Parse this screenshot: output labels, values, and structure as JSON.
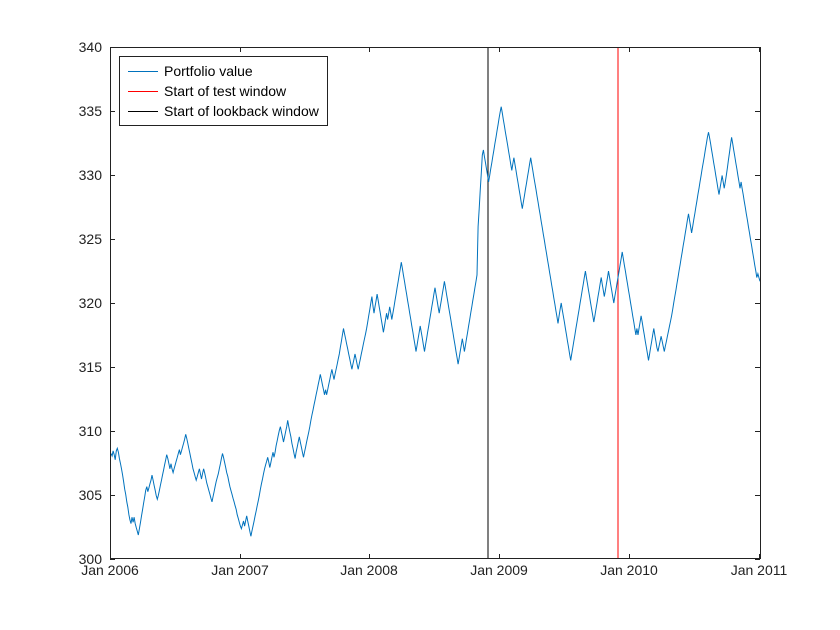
{
  "chart_data": {
    "type": "line",
    "xlabel": "",
    "ylabel": "",
    "title": "",
    "x_ticks": [
      "Jan 2006",
      "Jan 2007",
      "Jan 2008",
      "Jan 2009",
      "Jan 2010",
      "Jan 2011"
    ],
    "y_ticks": [
      300,
      305,
      310,
      315,
      320,
      325,
      330,
      335,
      340
    ],
    "xlim": [
      "2006-01-01",
      "2011-01-10"
    ],
    "ylim": [
      300,
      340
    ],
    "legend": {
      "position": "upper-left",
      "entries": [
        "Portfolio value",
        "Start of test window",
        "Start of lookback window"
      ]
    },
    "annotations": [
      {
        "type": "vline",
        "x": "2008-12-01",
        "color": "#000",
        "label": "Start of lookback window"
      },
      {
        "type": "vline",
        "x": "2009-12-01",
        "color": "#f00",
        "label": "Start of test window"
      }
    ],
    "series": [
      {
        "name": "Portfolio value",
        "color": "#0072BD",
        "x_start": "2006-01-01",
        "x_end": "2011-01-10",
        "values": [
          308.2,
          308.0,
          308.4,
          308.1,
          307.7,
          308.4,
          308.6,
          308.3,
          307.8,
          307.4,
          307.0,
          306.5,
          306.0,
          305.4,
          305.0,
          304.4,
          304.0,
          303.4,
          303.0,
          302.7,
          303.2,
          302.8,
          303.2,
          302.7,
          302.4,
          302.1,
          301.8,
          302.3,
          302.8,
          303.3,
          303.8,
          304.3,
          304.8,
          305.3,
          305.6,
          305.2,
          305.5,
          305.8,
          306.1,
          306.5,
          306.1,
          305.7,
          305.3,
          304.9,
          304.6,
          304.9,
          305.3,
          305.7,
          306.1,
          306.5,
          306.9,
          307.3,
          307.7,
          308.1,
          307.8,
          307.4,
          307.0,
          307.4,
          307.0,
          306.7,
          307.0,
          307.3,
          307.6,
          307.9,
          308.2,
          308.5,
          308.1,
          308.4,
          308.7,
          309.0,
          309.3,
          309.7,
          309.4,
          309.0,
          308.6,
          308.2,
          307.8,
          307.4,
          307.0,
          306.7,
          306.4,
          306.1,
          306.4,
          306.7,
          307.0,
          306.6,
          306.2,
          306.6,
          307.0,
          306.7,
          306.3,
          305.9,
          305.6,
          305.3,
          305.0,
          304.7,
          304.4,
          304.8,
          305.2,
          305.6,
          306.0,
          306.3,
          306.6,
          307.0,
          307.4,
          307.8,
          308.2,
          307.9,
          307.5,
          307.1,
          306.7,
          306.4,
          306.0,
          305.6,
          305.3,
          305.0,
          304.7,
          304.4,
          304.1,
          303.8,
          303.4,
          303.1,
          302.8,
          302.5,
          302.3,
          302.6,
          302.9,
          302.5,
          302.9,
          303.3,
          302.9,
          302.5,
          302.1,
          301.7,
          302.1,
          302.5,
          302.9,
          303.3,
          303.7,
          304.1,
          304.5,
          304.9,
          305.4,
          305.8,
          306.2,
          306.6,
          307.0,
          307.3,
          307.6,
          307.9,
          307.5,
          307.1,
          307.5,
          307.9,
          308.3,
          307.9,
          308.3,
          308.8,
          309.2,
          309.6,
          310.0,
          310.3,
          309.9,
          309.5,
          309.1,
          309.5,
          309.9,
          310.3,
          310.8,
          310.3,
          309.9,
          309.5,
          309.0,
          308.6,
          308.2,
          307.8,
          308.3,
          308.7,
          309.1,
          309.5,
          309.1,
          308.7,
          308.3,
          307.9,
          308.3,
          308.7,
          309.1,
          309.5,
          309.9,
          310.3,
          310.8,
          311.2,
          311.6,
          312.0,
          312.4,
          312.8,
          313.2,
          313.6,
          314.0,
          314.4,
          314.0,
          313.6,
          313.2,
          312.8,
          313.2,
          312.8,
          313.2,
          313.6,
          314.0,
          314.4,
          314.8,
          314.4,
          314.0,
          314.4,
          314.8,
          315.2,
          315.6,
          316.0,
          316.5,
          317.0,
          317.5,
          318.0,
          317.6,
          317.2,
          316.8,
          316.4,
          316.0,
          315.6,
          315.2,
          314.8,
          315.2,
          315.6,
          316.0,
          315.6,
          315.2,
          314.8,
          315.2,
          315.6,
          316.0,
          316.4,
          316.8,
          317.2,
          317.6,
          318.0,
          318.5,
          319.0,
          319.5,
          320.0,
          320.5,
          319.8,
          319.2,
          319.7,
          320.2,
          320.7,
          320.2,
          319.7,
          319.2,
          318.7,
          318.2,
          317.7,
          318.2,
          318.7,
          319.2,
          318.7,
          319.2,
          319.7,
          319.2,
          318.7,
          319.2,
          319.7,
          320.2,
          320.7,
          321.2,
          321.7,
          322.2,
          322.7,
          323.2,
          322.7,
          322.2,
          321.7,
          321.2,
          320.7,
          320.2,
          319.7,
          319.2,
          318.7,
          318.2,
          317.7,
          317.2,
          316.7,
          316.2,
          316.7,
          317.2,
          317.7,
          318.2,
          317.7,
          317.2,
          316.7,
          316.2,
          316.7,
          317.2,
          317.7,
          318.2,
          318.7,
          319.2,
          319.7,
          320.2,
          320.7,
          321.2,
          320.7,
          320.2,
          319.7,
          319.2,
          319.7,
          320.2,
          320.7,
          321.2,
          321.7,
          321.2,
          320.7,
          320.2,
          319.7,
          319.2,
          318.7,
          318.2,
          317.7,
          317.2,
          316.7,
          316.2,
          315.7,
          315.2,
          315.7,
          316.2,
          316.7,
          317.2,
          316.7,
          316.2,
          316.7,
          317.2,
          317.7,
          318.2,
          318.7,
          319.2,
          319.7,
          320.2,
          320.7,
          321.2,
          321.7,
          322.2,
          326.0,
          327.4,
          328.8,
          330.2,
          331.6,
          332.0,
          331.5,
          331.0,
          330.5,
          330.0,
          329.5,
          330.0,
          330.5,
          331.0,
          331.5,
          332.0,
          332.5,
          333.0,
          333.5,
          334.0,
          334.5,
          335.0,
          335.4,
          334.9,
          334.4,
          333.9,
          333.4,
          332.9,
          332.4,
          331.9,
          331.4,
          330.9,
          330.4,
          330.9,
          331.4,
          330.9,
          330.4,
          329.9,
          329.4,
          328.9,
          328.4,
          327.9,
          327.4,
          327.9,
          328.4,
          328.9,
          329.4,
          329.9,
          330.4,
          330.9,
          331.4,
          330.9,
          330.4,
          329.9,
          329.4,
          328.9,
          328.4,
          327.9,
          327.4,
          326.9,
          326.4,
          325.9,
          325.4,
          324.9,
          324.4,
          323.9,
          323.4,
          322.9,
          322.4,
          321.9,
          321.4,
          320.9,
          320.4,
          319.9,
          319.4,
          318.9,
          318.4,
          319.0,
          319.5,
          320.0,
          319.5,
          319.0,
          318.5,
          318.0,
          317.5,
          317.0,
          316.5,
          316.0,
          315.5,
          316.0,
          316.5,
          317.0,
          317.5,
          318.0,
          318.5,
          319.0,
          319.5,
          320.0,
          320.5,
          321.0,
          321.5,
          322.0,
          322.5,
          322.0,
          321.5,
          321.0,
          320.5,
          320.0,
          319.5,
          319.0,
          318.5,
          319.0,
          319.5,
          320.0,
          320.5,
          321.0,
          321.5,
          322.0,
          321.5,
          321.0,
          320.5,
          321.0,
          321.5,
          322.0,
          322.5,
          322.0,
          321.5,
          321.0,
          320.5,
          320.0,
          320.5,
          321.0,
          321.5,
          322.0,
          322.5,
          323.0,
          323.5,
          324.0,
          323.5,
          323.0,
          322.5,
          322.0,
          321.5,
          321.0,
          320.5,
          320.0,
          319.5,
          319.0,
          318.5,
          318.0,
          317.5,
          318.0,
          317.5,
          318.0,
          318.5,
          319.0,
          318.5,
          318.0,
          317.5,
          317.0,
          316.5,
          316.0,
          315.5,
          316.0,
          316.5,
          317.0,
          317.5,
          318.0,
          317.5,
          317.0,
          316.5,
          316.2,
          316.6,
          317.0,
          317.4,
          317.0,
          316.6,
          316.2,
          316.6,
          317.0,
          317.4,
          317.8,
          318.2,
          318.6,
          319.0,
          319.5,
          320.0,
          320.5,
          321.0,
          321.5,
          322.0,
          322.5,
          323.0,
          323.5,
          324.0,
          324.5,
          325.0,
          325.5,
          326.0,
          326.5,
          327.0,
          326.5,
          326.0,
          325.5,
          326.0,
          326.5,
          327.0,
          327.5,
          328.0,
          328.5,
          329.0,
          329.5,
          330.0,
          330.5,
          331.0,
          331.5,
          332.0,
          332.5,
          333.0,
          333.4,
          333.0,
          332.5,
          332.0,
          331.5,
          331.0,
          330.5,
          330.0,
          329.5,
          329.0,
          328.5,
          329.0,
          329.5,
          330.0,
          329.5,
          329.0,
          329.5,
          330.0,
          330.6,
          331.2,
          331.8,
          332.4,
          333.0,
          332.5,
          332.0,
          331.5,
          331.0,
          330.5,
          330.0,
          329.5,
          329.0,
          329.5,
          329.0,
          328.5,
          328.0,
          327.5,
          327.0,
          326.5,
          326.0,
          325.5,
          325.0,
          324.5,
          324.0,
          323.5,
          323.0,
          322.5,
          322.0,
          322.3,
          322.0,
          321.7
        ]
      }
    ]
  },
  "legend_labels": {
    "l0": "Portfolio value",
    "l1": "Start of test window",
    "l2": "Start of lookback window"
  },
  "yticks": {
    "t0": "300",
    "t1": "305",
    "t2": "310",
    "t3": "315",
    "t4": "320",
    "t5": "325",
    "t6": "330",
    "t7": "335",
    "t8": "340"
  },
  "xticks": {
    "t0": "Jan 2006",
    "t1": "Jan 2007",
    "t2": "Jan 2008",
    "t3": "Jan 2009",
    "t4": "Jan 2010",
    "t5": "Jan 2011"
  }
}
